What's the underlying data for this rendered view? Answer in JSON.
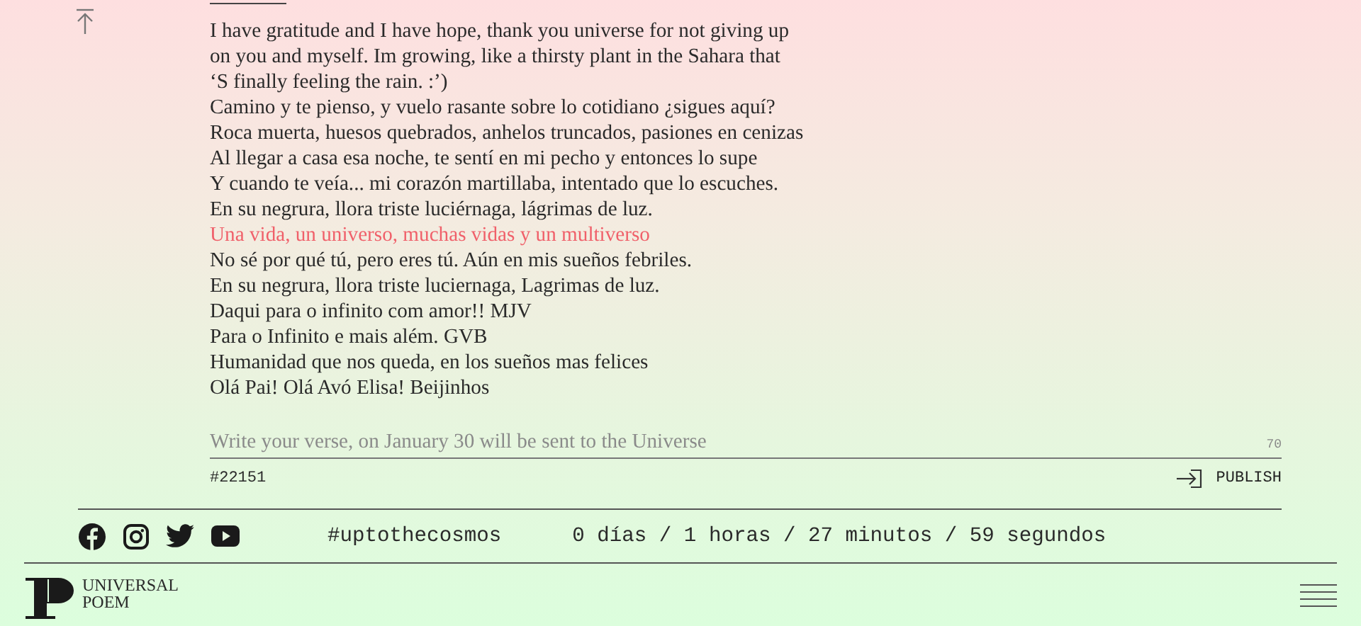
{
  "verses": [
    {
      "text": "I have gratitude and I have hope, thank you universe for not giving up",
      "highlighted": false
    },
    {
      "text": "on you and myself. Im growing, like a thirsty plant in the Sahara that",
      "highlighted": false
    },
    {
      "text": "‘S finally feeling the rain. :’)",
      "highlighted": false
    },
    {
      "text": "Camino y te pienso, y vuelo rasante sobre lo cotidiano ¿sigues aquí?",
      "highlighted": false
    },
    {
      "text": "Roca muerta, huesos quebrados, anhelos truncados, pasiones en cenizas",
      "highlighted": false
    },
    {
      "text": "Al llegar a casa esa noche, te sentí en mi pecho y entonces lo supe",
      "highlighted": false
    },
    {
      "text": "Y cuando te veía... mi corazón martillaba, intentado que lo escuches.",
      "highlighted": false
    },
    {
      "text": "En su negrura, llora triste luciérnaga, lágrimas de luz.",
      "highlighted": false
    },
    {
      "text": "Una vida, un universo, muchas vidas y un multiverso",
      "highlighted": true
    },
    {
      "text": "No sé por qué tú, pero eres tú. Aún en mis sueños febriles.",
      "highlighted": false
    },
    {
      "text": "En su negrura, llora triste luciernaga, Lagrimas de luz.",
      "highlighted": false
    },
    {
      "text": "Daqui para o infinito com amor!! MJV",
      "highlighted": false
    },
    {
      "text": "Para o Infinito e mais além. GVB",
      "highlighted": false
    },
    {
      "text": "Humanidad que nos queda, en los sueños mas felices",
      "highlighted": false
    },
    {
      "text": "Olá Pai! Olá Avó Elisa! Beijinhos",
      "highlighted": false
    }
  ],
  "verse_input": {
    "placeholder": "Write your verse, on January 30 will be sent to the Universe",
    "counter": "70"
  },
  "verse_number": "#22151",
  "publish_button": "PUBLISH",
  "social": {
    "hashtag": "#uptothecosmos",
    "countdown": "0 días / 1 horas / 27 minutos / 59 segundos"
  },
  "logo": {
    "line_1": "UNIVERSAL",
    "line_2": "POEM"
  }
}
